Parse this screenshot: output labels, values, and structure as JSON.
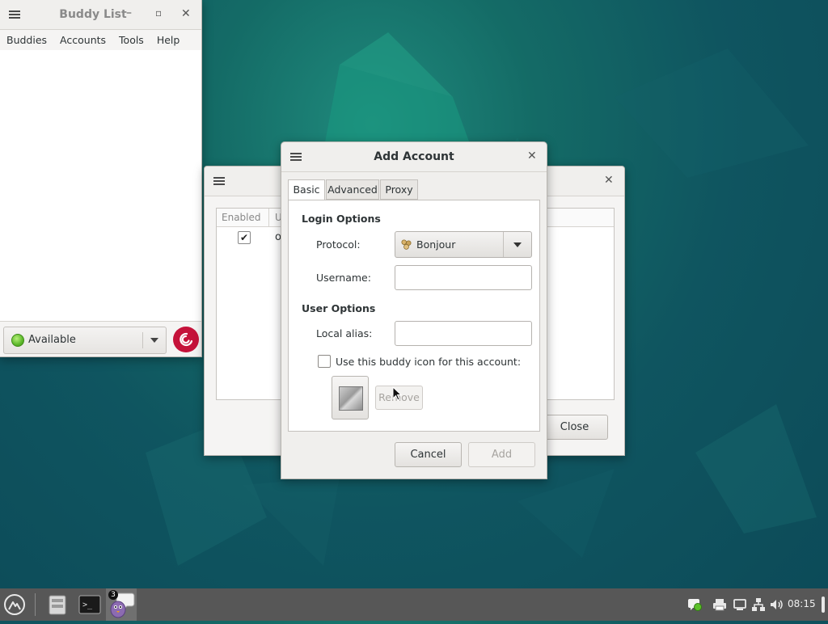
{
  "buddy_list": {
    "title": "Buddy List",
    "menu": [
      "Buddies",
      "Accounts",
      "Tools",
      "Help"
    ],
    "status": "Available"
  },
  "accounts_window": {
    "columns": [
      "Enabled",
      "U"
    ],
    "rows": [
      {
        "enabled": true,
        "text": "o"
      }
    ],
    "close_label": "Close"
  },
  "add_account": {
    "title": "Add Account",
    "tabs": [
      "Basic",
      "Advanced",
      "Proxy"
    ],
    "active_tab": "Basic",
    "login_options": "Login Options",
    "protocol_label": "Protocol:",
    "protocol_value": "Bonjour",
    "username_label": "Username:",
    "username_value": "",
    "user_options": "User Options",
    "alias_label": "Local alias:",
    "alias_value": "",
    "buddy_icon_label": "Use this buddy icon for this account:",
    "buddy_icon_checked": false,
    "remove_label": "Remove",
    "cancel_label": "Cancel",
    "add_label": "Add"
  },
  "taskbar": {
    "pidgin_badge": "3",
    "clock": "08:15",
    "icons": [
      "menu-icon",
      "file-manager-icon",
      "terminal-icon",
      "pidgin-icon",
      "notification-icon",
      "printer-icon",
      "display-icon",
      "network-icon",
      "volume-icon",
      "power-icon"
    ]
  }
}
